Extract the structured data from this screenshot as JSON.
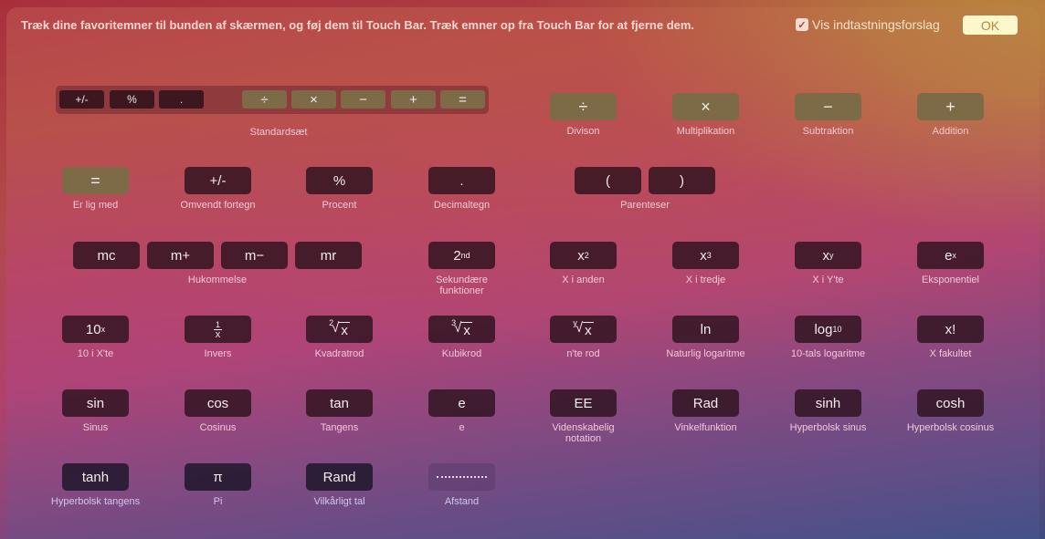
{
  "header": {
    "instruction": "Træk dine favoritemner til bunden af skærmen, og føj dem til Touch Bar. Træk emner op fra Touch Bar for at fjerne dem.",
    "suggestions_label": "Vis indtastningsforslag",
    "suggestions_checked": true,
    "ok_label": "OK"
  },
  "standard_set": {
    "label": "Standardsæt",
    "keys": [
      "+/-",
      "%",
      ".",
      "÷",
      "×",
      "−",
      "+",
      "="
    ]
  },
  "items": {
    "division": {
      "key": "÷",
      "label": "Divison"
    },
    "multiplication": {
      "key": "×",
      "label": "Multiplikation"
    },
    "subtraction": {
      "key": "−",
      "label": "Subtraktion"
    },
    "addition": {
      "key": "+",
      "label": "Addition"
    },
    "equals": {
      "key": "=",
      "label": "Er lig med"
    },
    "negate": {
      "key": "+/-",
      "label": "Omvendt fortegn"
    },
    "percent": {
      "key": "%",
      "label": "Procent"
    },
    "decimal": {
      "key": ".",
      "label": "Decimaltegn"
    },
    "parens": {
      "open": "(",
      "close": ")",
      "label": "Parenteser"
    },
    "memory": {
      "keys": [
        "mc",
        "m+",
        "m−",
        "mr"
      ],
      "label": "Hukommelse"
    },
    "second": {
      "key": "2",
      "sup": "nd",
      "label": "Sekundære funktioner"
    },
    "x2": {
      "base": "x",
      "sup": "2",
      "label": "X i anden"
    },
    "x3": {
      "base": "x",
      "sup": "3",
      "label": "X i tredje"
    },
    "xy": {
      "base": "x",
      "sup": "y",
      "label": "X i Y'te"
    },
    "ex": {
      "base": "e",
      "sup": "x",
      "label": "Eksponentiel"
    },
    "tenx": {
      "base": "10",
      "sup": "x",
      "label": "10 i X'te"
    },
    "inverse": {
      "num": "1",
      "den": "x",
      "label": "Invers"
    },
    "sqrt": {
      "index": "2",
      "radicand": "x",
      "label": "Kvadratrod"
    },
    "cbrt": {
      "index": "3",
      "radicand": "x",
      "label": "Kubikrod"
    },
    "nroot": {
      "index": "y",
      "radicand": "x",
      "label": "n'te rod"
    },
    "ln": {
      "key": "ln",
      "label": "Naturlig logaritme"
    },
    "log10": {
      "base": "log",
      "sub": "10",
      "label": "10-tals logaritme"
    },
    "factorial": {
      "key": "x!",
      "label": "X fakultet"
    },
    "sin": {
      "key": "sin",
      "label": "Sinus"
    },
    "cos": {
      "key": "cos",
      "label": "Cosinus"
    },
    "tan": {
      "key": "tan",
      "label": "Tangens"
    },
    "e": {
      "key": "e",
      "label": "e"
    },
    "ee": {
      "key": "EE",
      "label": "Videnskabelig notation"
    },
    "rad": {
      "key": "Rad",
      "label": "Vinkelfunktion"
    },
    "sinh": {
      "key": "sinh",
      "label": "Hyperbolsk sinus"
    },
    "cosh": {
      "key": "cosh",
      "label": "Hyperbolsk cosinus"
    },
    "tanh": {
      "key": "tanh",
      "label": "Hyperbolsk tangens"
    },
    "pi": {
      "key": "π",
      "label": "Pi"
    },
    "rand": {
      "key": "Rand",
      "label": "Vilkårligt tal"
    },
    "space": {
      "label": "Afstand"
    }
  }
}
